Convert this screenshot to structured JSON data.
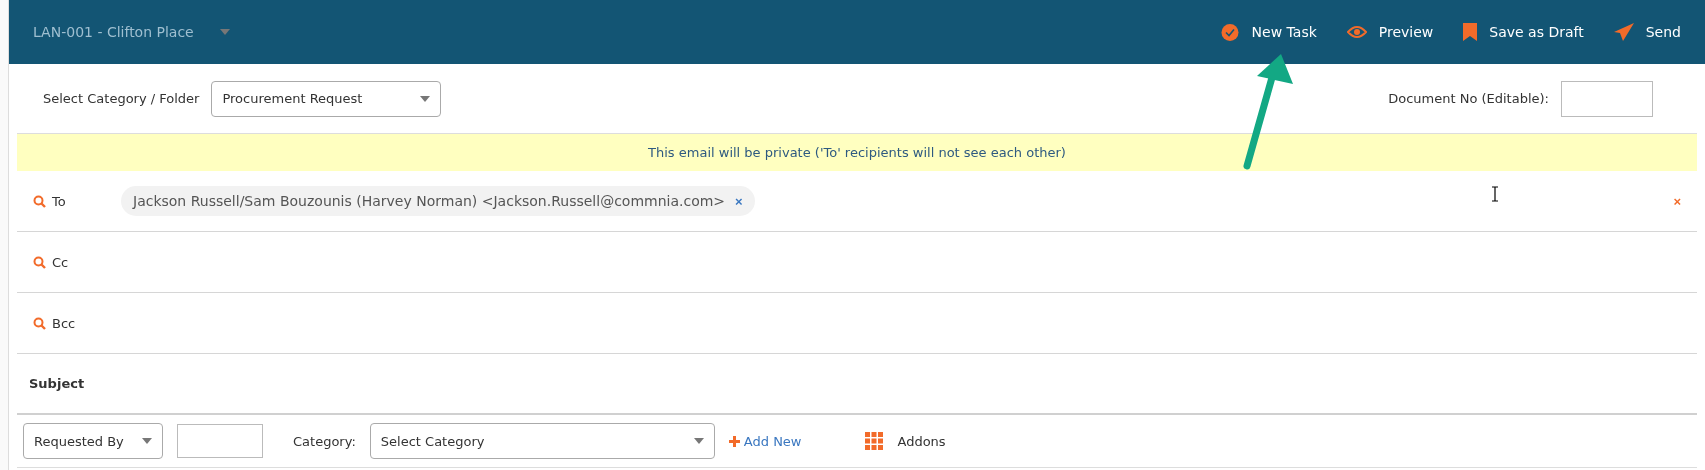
{
  "header": {
    "project": "LAN-001 - Clifton Place",
    "actions": [
      {
        "kind": "task",
        "label": "New Task"
      },
      {
        "kind": "preview",
        "label": "Preview"
      },
      {
        "kind": "draft",
        "label": "Save as Draft"
      },
      {
        "kind": "send",
        "label": "Send"
      }
    ]
  },
  "category_row": {
    "label": "Select Category / Folder",
    "value": "Procurement Request",
    "document_no_label": "Document No (Editable):"
  },
  "notice": "This email will be private ('To' recipients will not see each other)",
  "recipients": [
    {
      "label": "To",
      "chips": [
        {
          "text": "Jackson Russell/Sam Bouzounis (Harvey Norman) <Jackson.Russell@commnia.com>",
          "remove": "×"
        }
      ],
      "clear": "×"
    },
    {
      "label": "Cc"
    },
    {
      "label": "Bcc"
    }
  ],
  "subject_label": "Subject",
  "footer": {
    "requested_by": "Requested By",
    "category_label": "Category:",
    "category_value": "Select Category",
    "add_new": "Add New",
    "addons": "Addons"
  }
}
